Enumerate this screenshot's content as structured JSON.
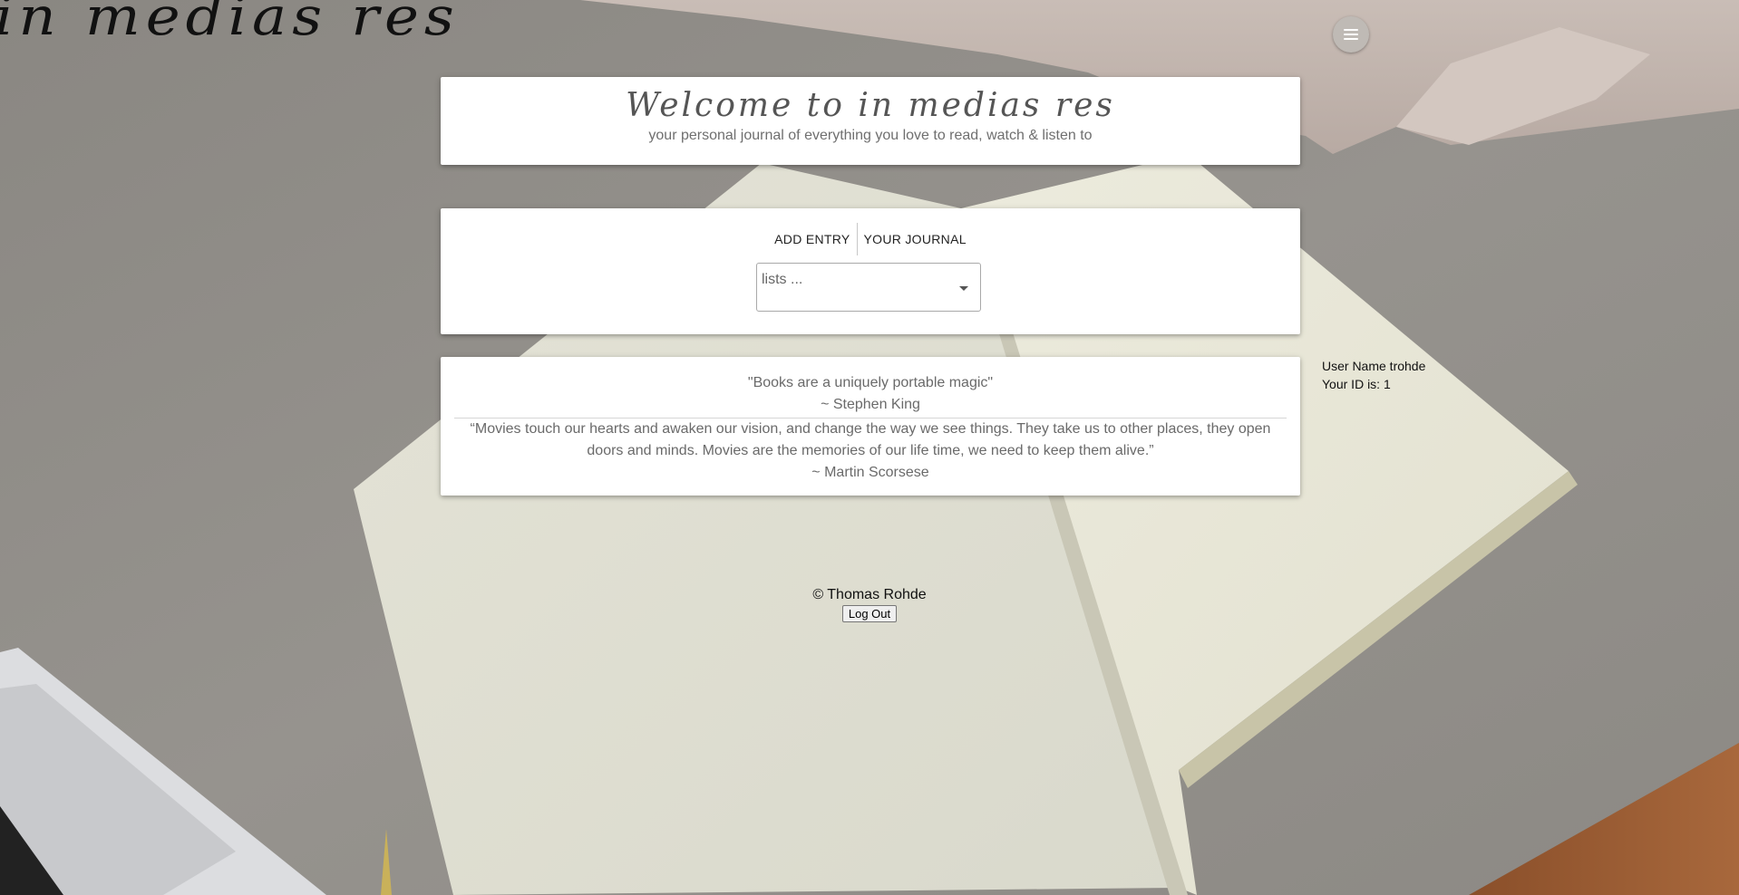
{
  "app": {
    "logo_text": "in medias res"
  },
  "welcome": {
    "title": "Welcome to in medias res",
    "subtitle": "your personal journal of everything you love to read, watch & listen to"
  },
  "nav": {
    "tabs": [
      {
        "label": "ADD ENTRY"
      },
      {
        "label": "YOUR JOURNAL"
      }
    ],
    "lists_select": {
      "placeholder": "lists ..."
    }
  },
  "quotes": [
    {
      "text": "\"Books are a uniquely portable magic\"",
      "author": "~ Stephen King"
    },
    {
      "text": "“Movies touch our hearts and awaken our vision, and change the way we see things. They take us to other places, they open doors and minds. Movies are the memories of our life time, we need to keep them alive.”",
      "author": "~ Martin Scorsese"
    }
  ],
  "user": {
    "name_line": "User Name trohde",
    "id_line": "Your ID is: 1"
  },
  "footer": {
    "copyright": "© Thomas Rohde",
    "logout_label": "Log Out"
  },
  "icons": {
    "menu": "hamburger-menu-icon",
    "dropdown": "caret-down-icon"
  },
  "colors": {
    "card_bg": "#ffffff",
    "menu_button_bg": "#bfbab5",
    "text_muted": "#6a6a6a"
  }
}
